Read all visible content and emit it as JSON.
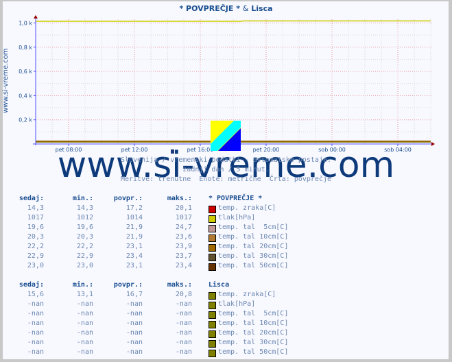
{
  "title": {
    "main": "* POVPREČJE *",
    "amp": "&",
    "station": "Lisca"
  },
  "side_label": "www.si-vreme.com",
  "watermark": "www.si-vreme.com",
  "captions": [
    "Slovenija / vremenski podatki - avtomatske postaje.",
    "zadnji dan / 5 minut.",
    "Meritve: trenutne  Enote: metrične  Črta: povprečje"
  ],
  "chart_data": {
    "type": "line",
    "title": "* POVPREČJE * & Lisca",
    "xlabel": "",
    "ylabel": "",
    "y_tick_labels": [
      "0,2 k",
      "0,4 k",
      "0,6 k",
      "0,8 k",
      "1,0 k"
    ],
    "y_ticks": [
      200,
      400,
      600,
      800,
      1000
    ],
    "ylim": [
      0,
      1020
    ],
    "x_tick_labels": [
      "pet 08:00",
      "pet 12:00",
      "pet 16:00",
      "pet 20:00",
      "sob 00:00",
      "sob 04:00"
    ],
    "x_ticks_hours": [
      2,
      6,
      10,
      14,
      18,
      22
    ],
    "xlim_hours": [
      0,
      24
    ],
    "grid": true,
    "series": [
      {
        "name": "tlak[hPa]",
        "color": "#cccc00",
        "points": [
          [
            0,
            1014
          ],
          [
            12.5,
            1014
          ],
          [
            12.6,
            1017
          ],
          [
            24,
            1017
          ]
        ]
      },
      {
        "name": "temp. tal 50cm[C]",
        "color": "#663300",
        "points": [
          [
            0,
            23
          ],
          [
            24,
            23
          ]
        ]
      },
      {
        "name": "temp. tal 20cm[C]",
        "color": "#996600",
        "points": [
          [
            0,
            22
          ],
          [
            24,
            22
          ]
        ]
      },
      {
        "name": "temp. zraka[C]",
        "color": "#cc0000",
        "points": [
          [
            0,
            17
          ],
          [
            24,
            17
          ]
        ]
      },
      {
        "name": "Lisca temp. zraka[C]",
        "color": "#808000",
        "points": [
          [
            0,
            16
          ],
          [
            24,
            16
          ]
        ]
      }
    ]
  },
  "table_avg": {
    "headers": [
      "sedaj:",
      "min.:",
      "povpr.:",
      "maks.:"
    ],
    "section": "* POVPREČJE *",
    "rows": [
      {
        "now": "14,3",
        "min": "14,3",
        "avg": "17,2",
        "max": "20,1",
        "color": "#cc0000",
        "label": "temp. zraka[C]"
      },
      {
        "now": "1017",
        "min": "1012",
        "avg": "1014",
        "max": "1017",
        "color": "#cccc00",
        "label": "tlak[hPa]"
      },
      {
        "now": "19,6",
        "min": "19,6",
        "avg": "21,9",
        "max": "24,7",
        "color": "#c09898",
        "label": "temp. tal  5cm[C]"
      },
      {
        "now": "20,3",
        "min": "20,3",
        "avg": "21,9",
        "max": "23,6",
        "color": "#b07830",
        "label": "temp. tal 10cm[C]"
      },
      {
        "now": "22,2",
        "min": "22,2",
        "avg": "23,1",
        "max": "23,9",
        "color": "#a06800",
        "label": "temp. tal 20cm[C]"
      },
      {
        "now": "22,9",
        "min": "22,9",
        "avg": "23,4",
        "max": "23,7",
        "color": "#605030",
        "label": "temp. tal 30cm[C]"
      },
      {
        "now": "23,0",
        "min": "23,0",
        "avg": "23,1",
        "max": "23,4",
        "color": "#663300",
        "label": "temp. tal 50cm[C]"
      }
    ]
  },
  "table_station": {
    "headers": [
      "sedaj:",
      "min.:",
      "povpr.:",
      "maks.:"
    ],
    "section": "Lisca",
    "rows": [
      {
        "now": "15,6",
        "min": "13,1",
        "avg": "16,7",
        "max": "20,8",
        "color": "#808000",
        "label": "temp. zraka[C]"
      },
      {
        "now": "-nan",
        "min": "-nan",
        "avg": "-nan",
        "max": "-nan",
        "color": "#808000",
        "label": "tlak[hPa]"
      },
      {
        "now": "-nan",
        "min": "-nan",
        "avg": "-nan",
        "max": "-nan",
        "color": "#808000",
        "label": "temp. tal  5cm[C]"
      },
      {
        "now": "-nan",
        "min": "-nan",
        "avg": "-nan",
        "max": "-nan",
        "color": "#808000",
        "label": "temp. tal 10cm[C]"
      },
      {
        "now": "-nan",
        "min": "-nan",
        "avg": "-nan",
        "max": "-nan",
        "color": "#808000",
        "label": "temp. tal 20cm[C]"
      },
      {
        "now": "-nan",
        "min": "-nan",
        "avg": "-nan",
        "max": "-nan",
        "color": "#808000",
        "label": "temp. tal 30cm[C]"
      },
      {
        "now": "-nan",
        "min": "-nan",
        "avg": "-nan",
        "max": "-nan",
        "color": "#808000",
        "label": "temp. tal 50cm[C]"
      }
    ]
  }
}
